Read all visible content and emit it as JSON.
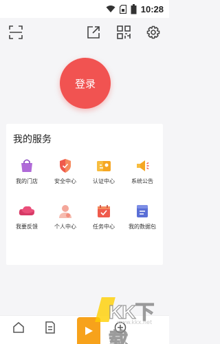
{
  "status_bar": {
    "time": "10:28"
  },
  "login": {
    "label": "登录"
  },
  "services": {
    "title": "我的服务",
    "items": [
      {
        "label": "我的门店",
        "icon": "shop-bag-icon",
        "color": "#b06ad8"
      },
      {
        "label": "安全中心",
        "icon": "shield-icon",
        "color": "#ef5a4c"
      },
      {
        "label": "认证中心",
        "icon": "certificate-icon",
        "color": "#f5a623"
      },
      {
        "label": "系统公告",
        "icon": "megaphone-icon",
        "color": "#f5a623"
      },
      {
        "label": "我要反馈",
        "icon": "feedback-cloud-icon",
        "color": "#ea4f7a"
      },
      {
        "label": "个人中心",
        "icon": "person-icon",
        "color": "#f4a79a"
      },
      {
        "label": "任务中心",
        "icon": "calendar-check-icon",
        "color": "#ef5a4c"
      },
      {
        "label": "我的数据包",
        "icon": "data-pack-icon",
        "color": "#5a6fd6"
      }
    ]
  },
  "watermark": {
    "text": "KK下载",
    "url": "www.kkx.net"
  }
}
